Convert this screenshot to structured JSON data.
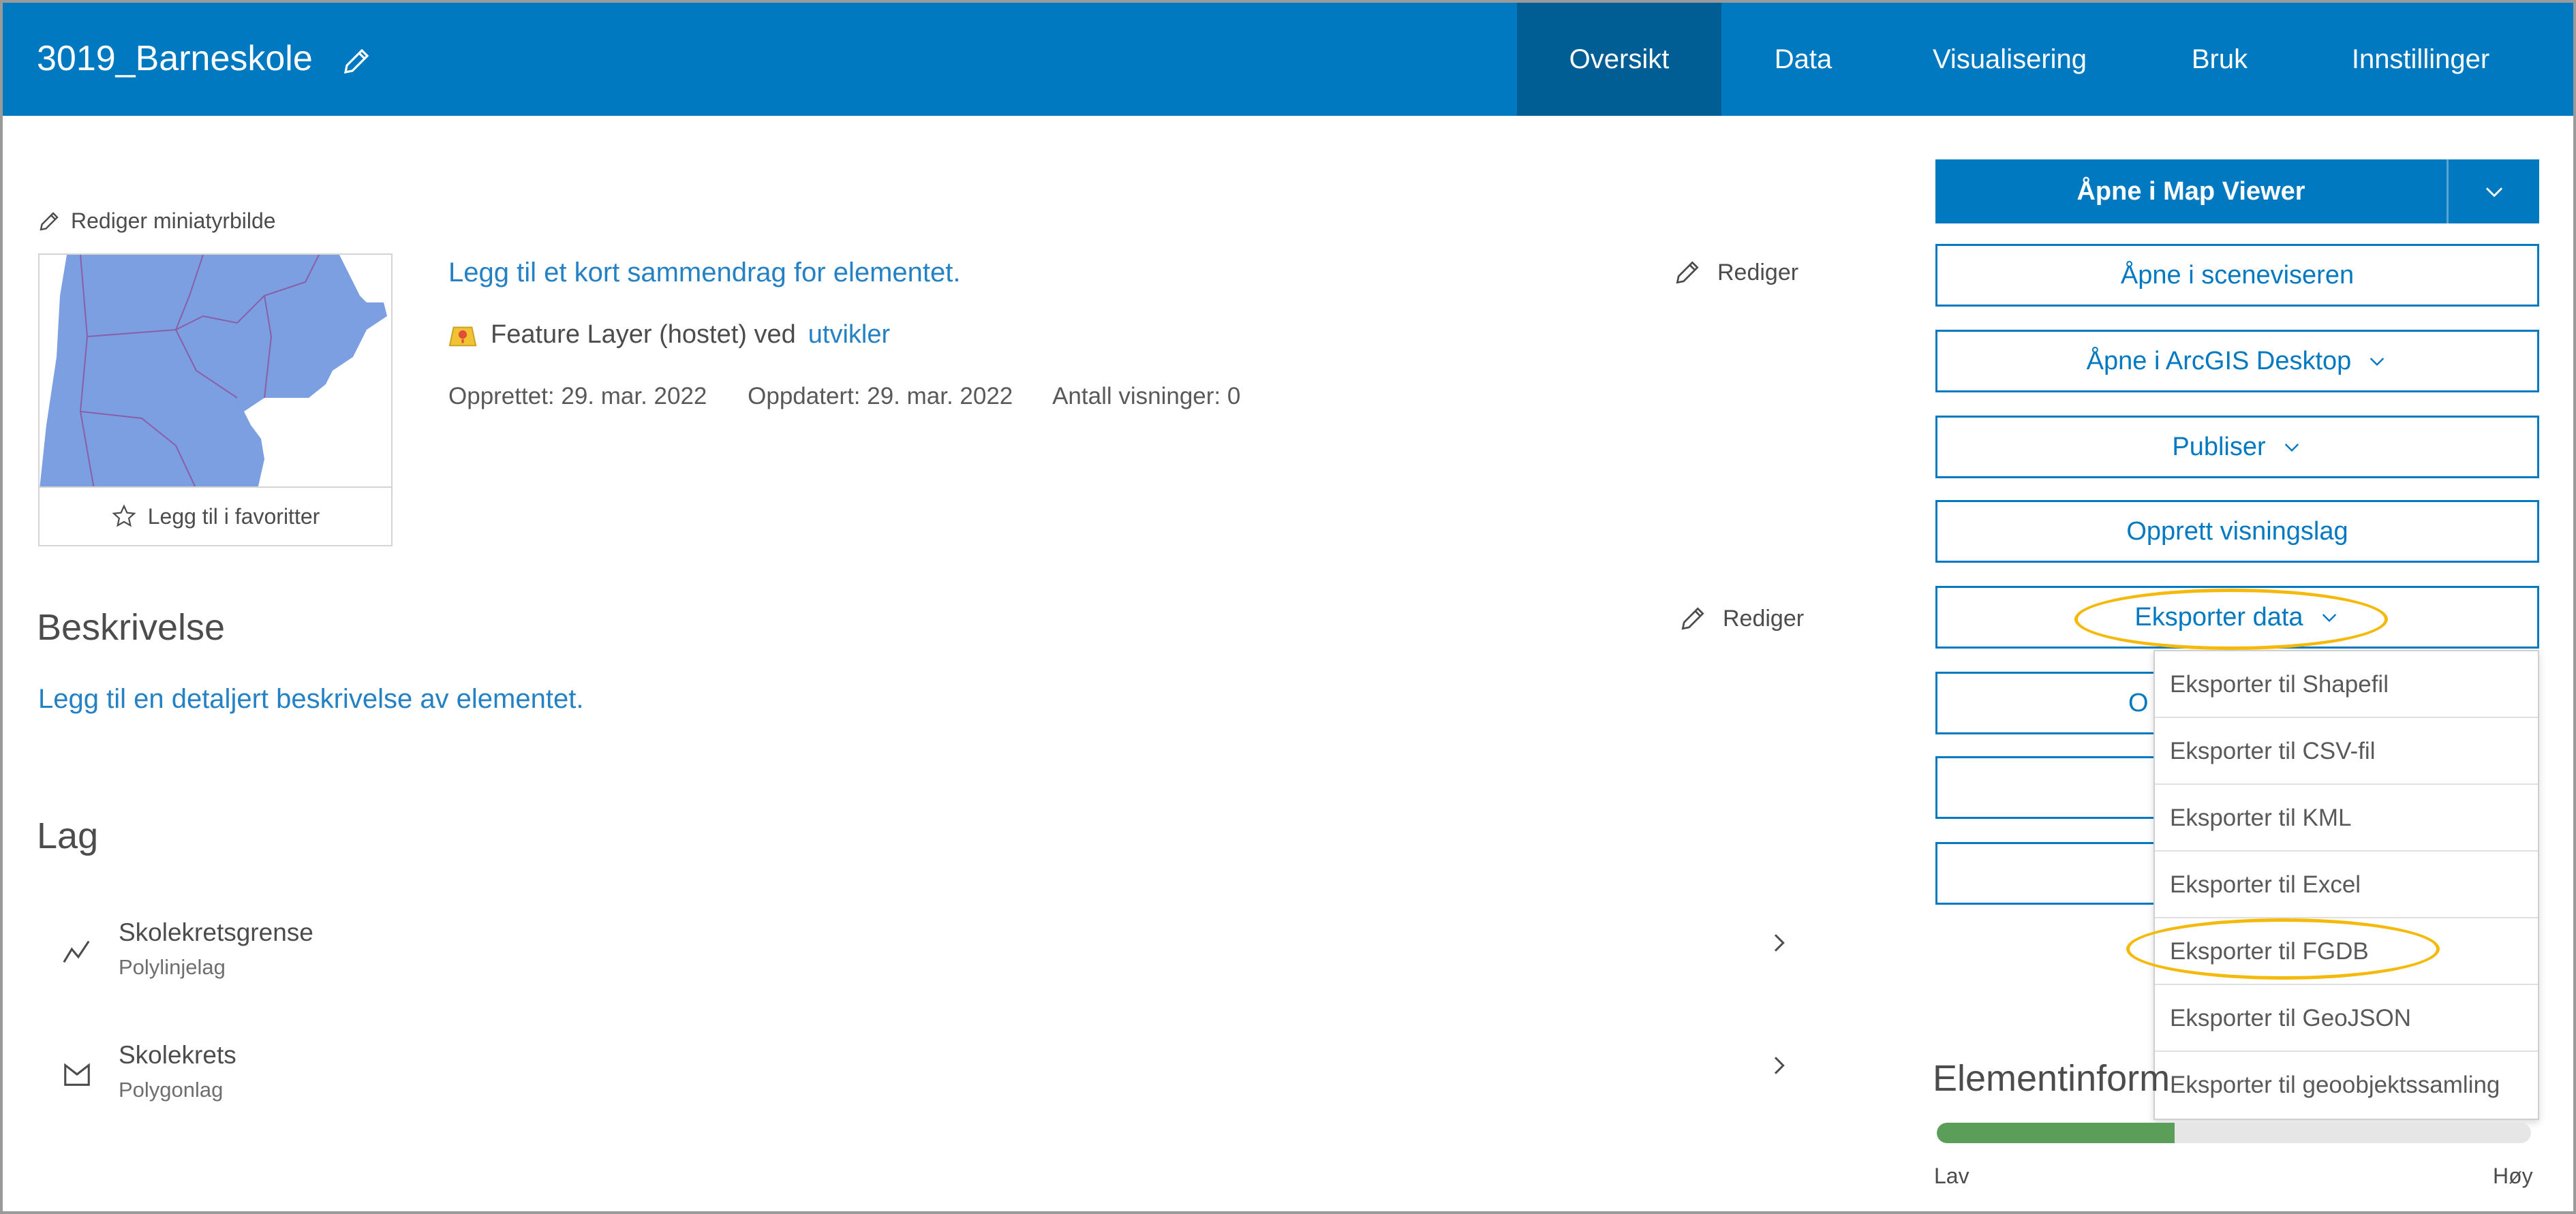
{
  "header": {
    "title": "3019_Barneskole",
    "tabs": [
      {
        "label": "Oversikt",
        "active": true
      },
      {
        "label": "Data",
        "active": false
      },
      {
        "label": "Visualisering",
        "active": false
      },
      {
        "label": "Bruk",
        "active": false
      },
      {
        "label": "Innstillinger",
        "active": false
      }
    ]
  },
  "thumbnail": {
    "edit_label": "Rediger miniatyrbilde",
    "favorite_label": "Legg til i favoritter"
  },
  "summary": {
    "add_summary_link": "Legg til et kort sammendrag for elementet.",
    "edit_label": "Rediger",
    "item_type": "Feature Layer (hostet) ved",
    "owner": "utvikler",
    "created": "Opprettet: 29. mar. 2022",
    "updated": "Oppdatert: 29. mar. 2022",
    "views": "Antall visninger: 0"
  },
  "description": {
    "title": "Beskrivelse",
    "edit_label": "Rediger",
    "add_link": "Legg til en detaljert beskrivelse av elementet."
  },
  "layers": {
    "title": "Lag",
    "items": [
      {
        "name": "Skolekretsgrense",
        "type": "Polylinjelag",
        "icon": "polyline-icon"
      },
      {
        "name": "Skolekrets",
        "type": "Polygonlag",
        "icon": "polygon-icon"
      }
    ]
  },
  "actions": {
    "open_map_viewer": "Åpne i Map Viewer",
    "open_scene_viewer": "Åpne i sceneviseren",
    "open_desktop": "Åpne i ArcGIS Desktop",
    "publish": "Publiser",
    "create_view": "Opprett visningslag",
    "export_data": "Eksporter data",
    "hidden_button_initial": "O"
  },
  "export_menu": {
    "items": [
      "Eksporter til Shapefil",
      "Eksporter til CSV-fil",
      "Eksporter til KML",
      "Eksporter til Excel",
      "Eksporter til FGDB",
      "Eksporter til GeoJSON",
      "Eksporter til geoobjektssamling"
    ]
  },
  "element_info": {
    "title": "Elementinform",
    "low_label": "Lav",
    "high_label": "Høy",
    "progress_fraction": 0.4
  },
  "colors": {
    "brand_blue": "#0079c1",
    "active_tab": "#005e95",
    "link_blue": "#2481c4",
    "highlight": "#f5b90a",
    "progress_green": "#5a9e5a"
  }
}
